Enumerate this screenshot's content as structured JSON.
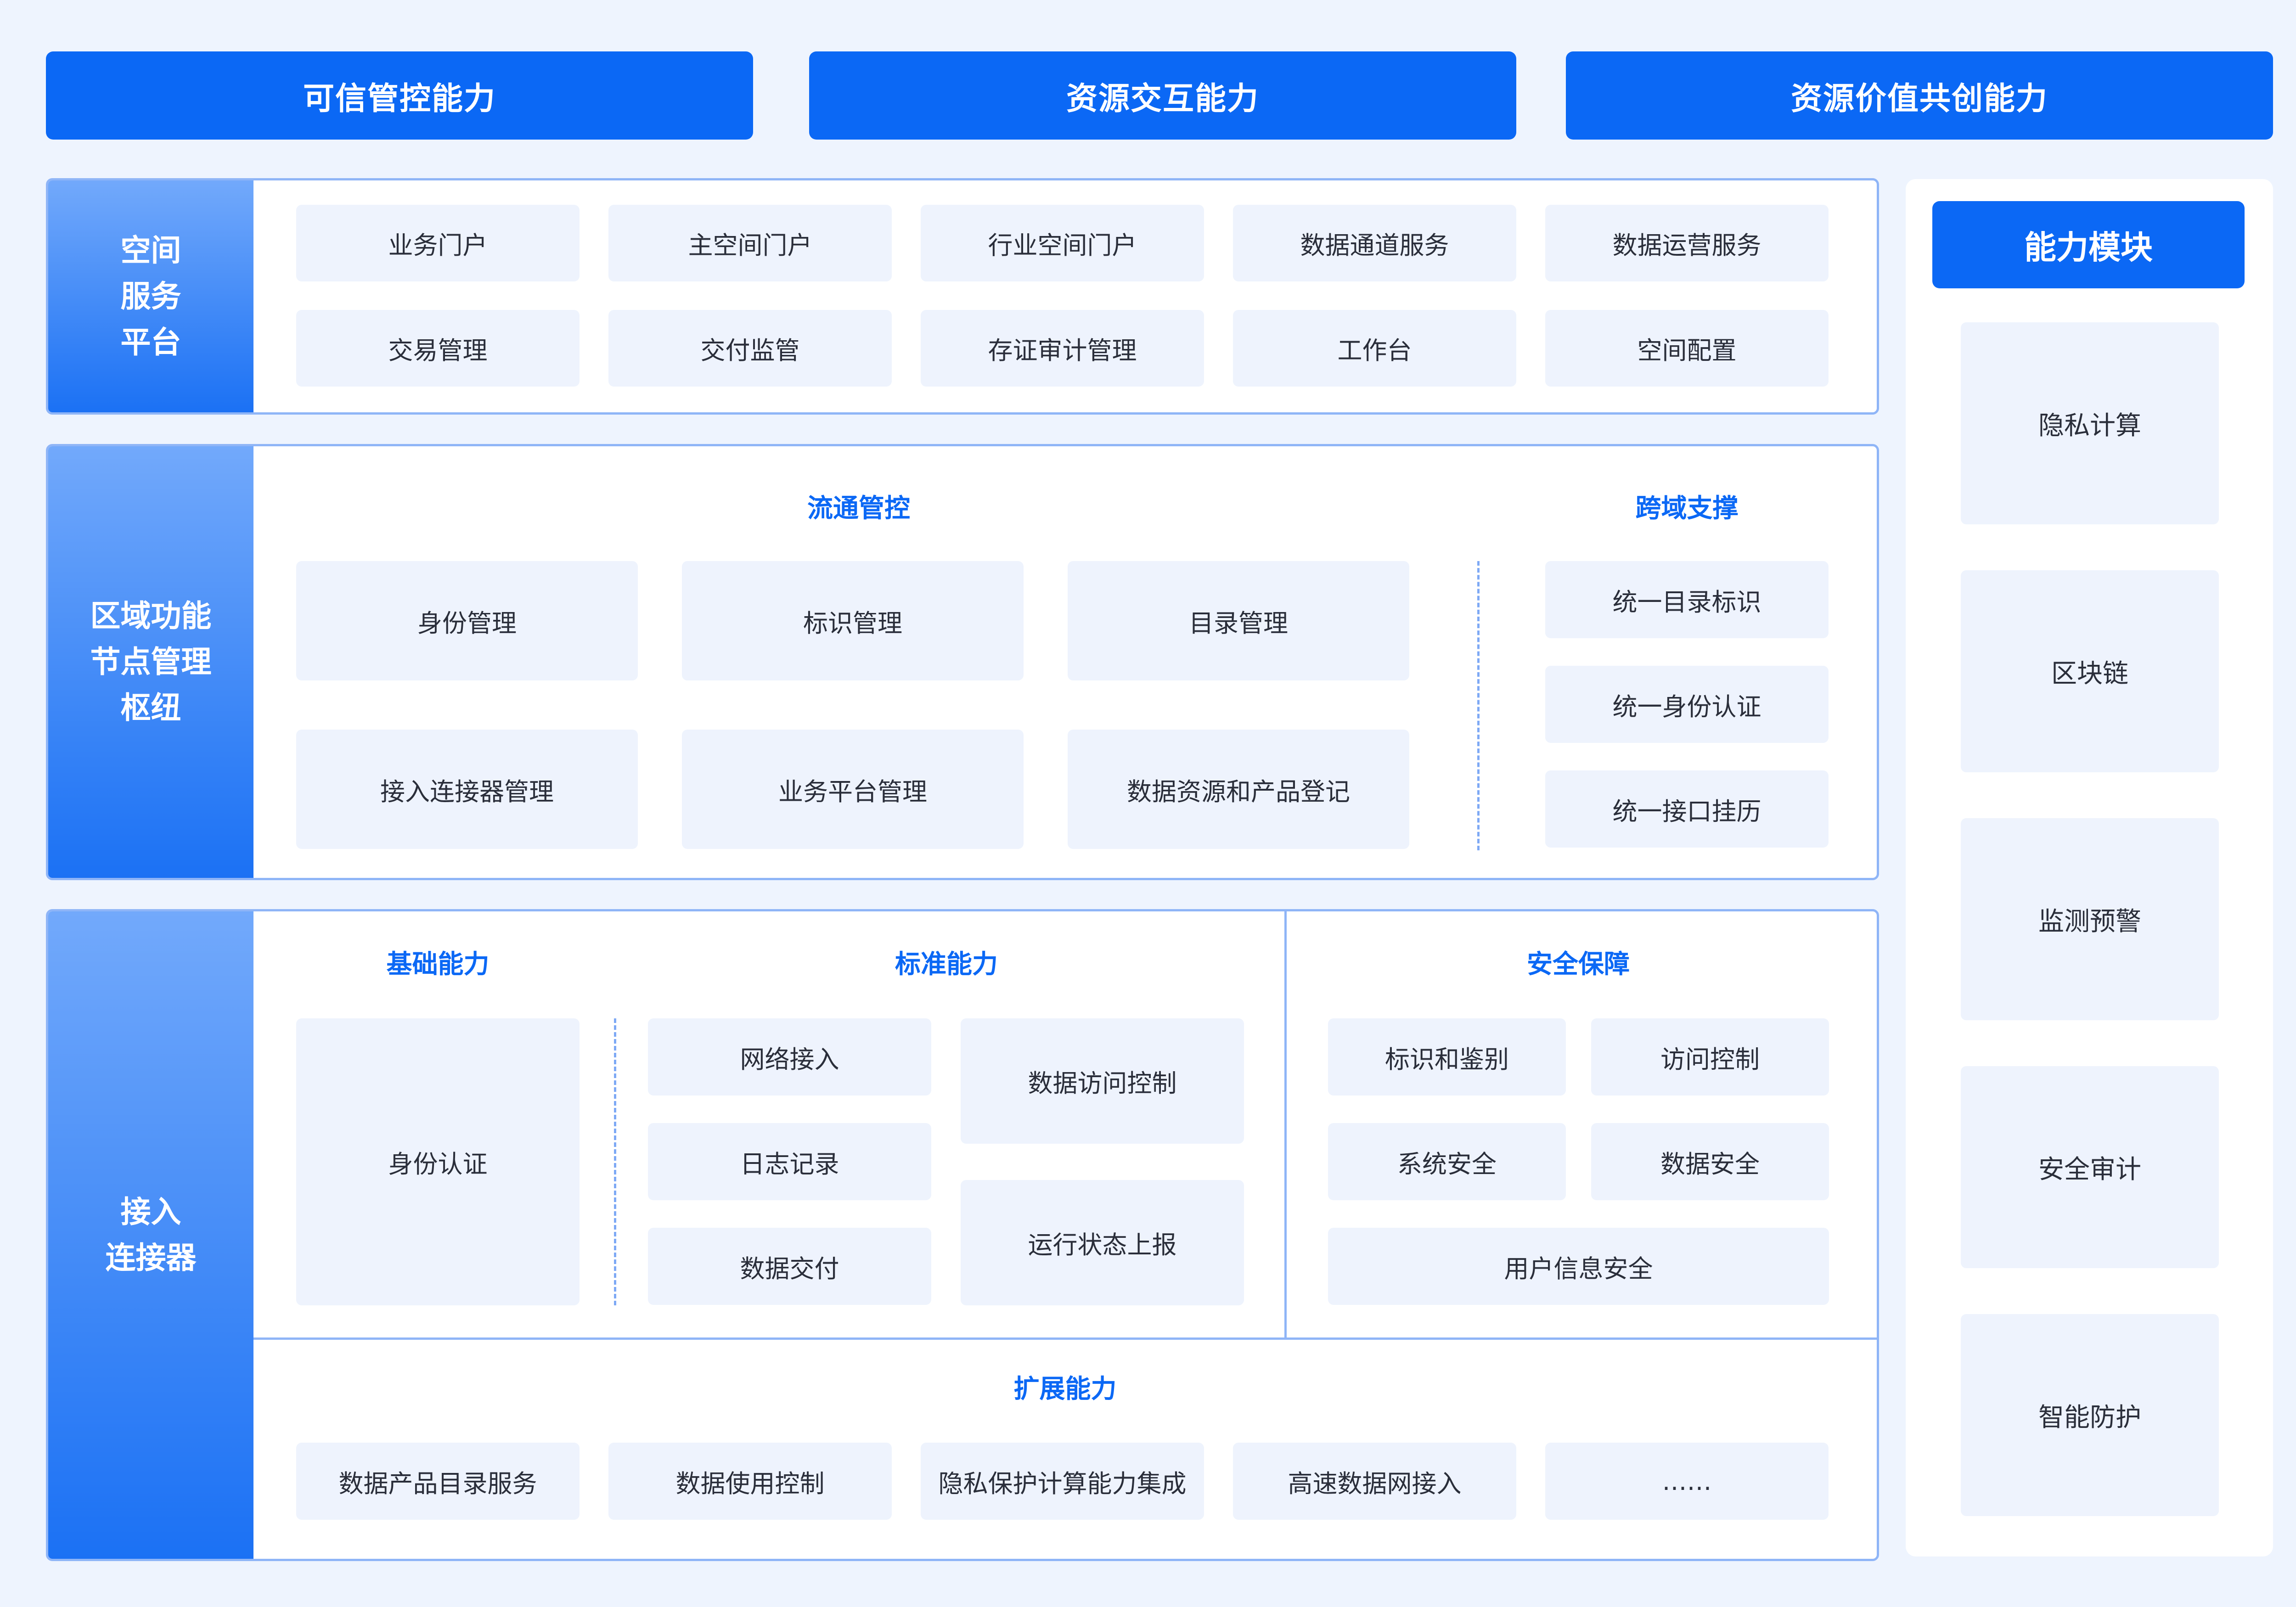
{
  "top_capabilities": [
    "可信管控能力",
    "资源交互能力",
    "资源价值共创能力"
  ],
  "space_platform": {
    "label": "空间\n服务\n平台",
    "items": [
      "业务门户",
      "主空间门户",
      "行业空间门户",
      "数据通道服务",
      "数据运营服务",
      "交易管理",
      "交付监管",
      "存证审计管理",
      "工作台",
      "空间配置"
    ]
  },
  "regional_hub": {
    "label": "区域功能\n节点管理\n枢纽",
    "circulation_title": "流通管控",
    "circulation_items": [
      "身份管理",
      "标识管理",
      "目录管理",
      "接入连接器管理",
      "业务平台管理",
      "数据资源和产品登记"
    ],
    "cross_domain_title": "跨域支撑",
    "cross_domain_items": [
      "统一目录标识",
      "统一身份认证",
      "统一接口挂历"
    ]
  },
  "connector": {
    "label": "接入\n连接器",
    "basic_title": "基础能力",
    "basic_item": "身份认证",
    "standard_title": "标准能力",
    "standard_left": [
      "网络接入",
      "日志记录",
      "数据交付"
    ],
    "standard_right": [
      "数据访问控制",
      "运行状态上报"
    ],
    "security_title": "安全保障",
    "security_items": [
      "标识和鉴别",
      "访问控制",
      "系统安全",
      "数据安全",
      "用户信息安全"
    ],
    "extension_title": "扩展能力",
    "extension_items": [
      "数据产品目录服务",
      "数据使用控制",
      "隐私保护计算能力集成",
      "高速数据网接入",
      "……"
    ]
  },
  "capability_module": {
    "title": "能力模块",
    "items": [
      "隐私计算",
      "区块链",
      "监测预警",
      "安全审计",
      "智能防护"
    ]
  },
  "colors": {
    "accent": "#0B68F5",
    "cell_bg": "#EEF3FD",
    "page_bg": "#EEF4FE",
    "border": "#8FB5F7"
  }
}
